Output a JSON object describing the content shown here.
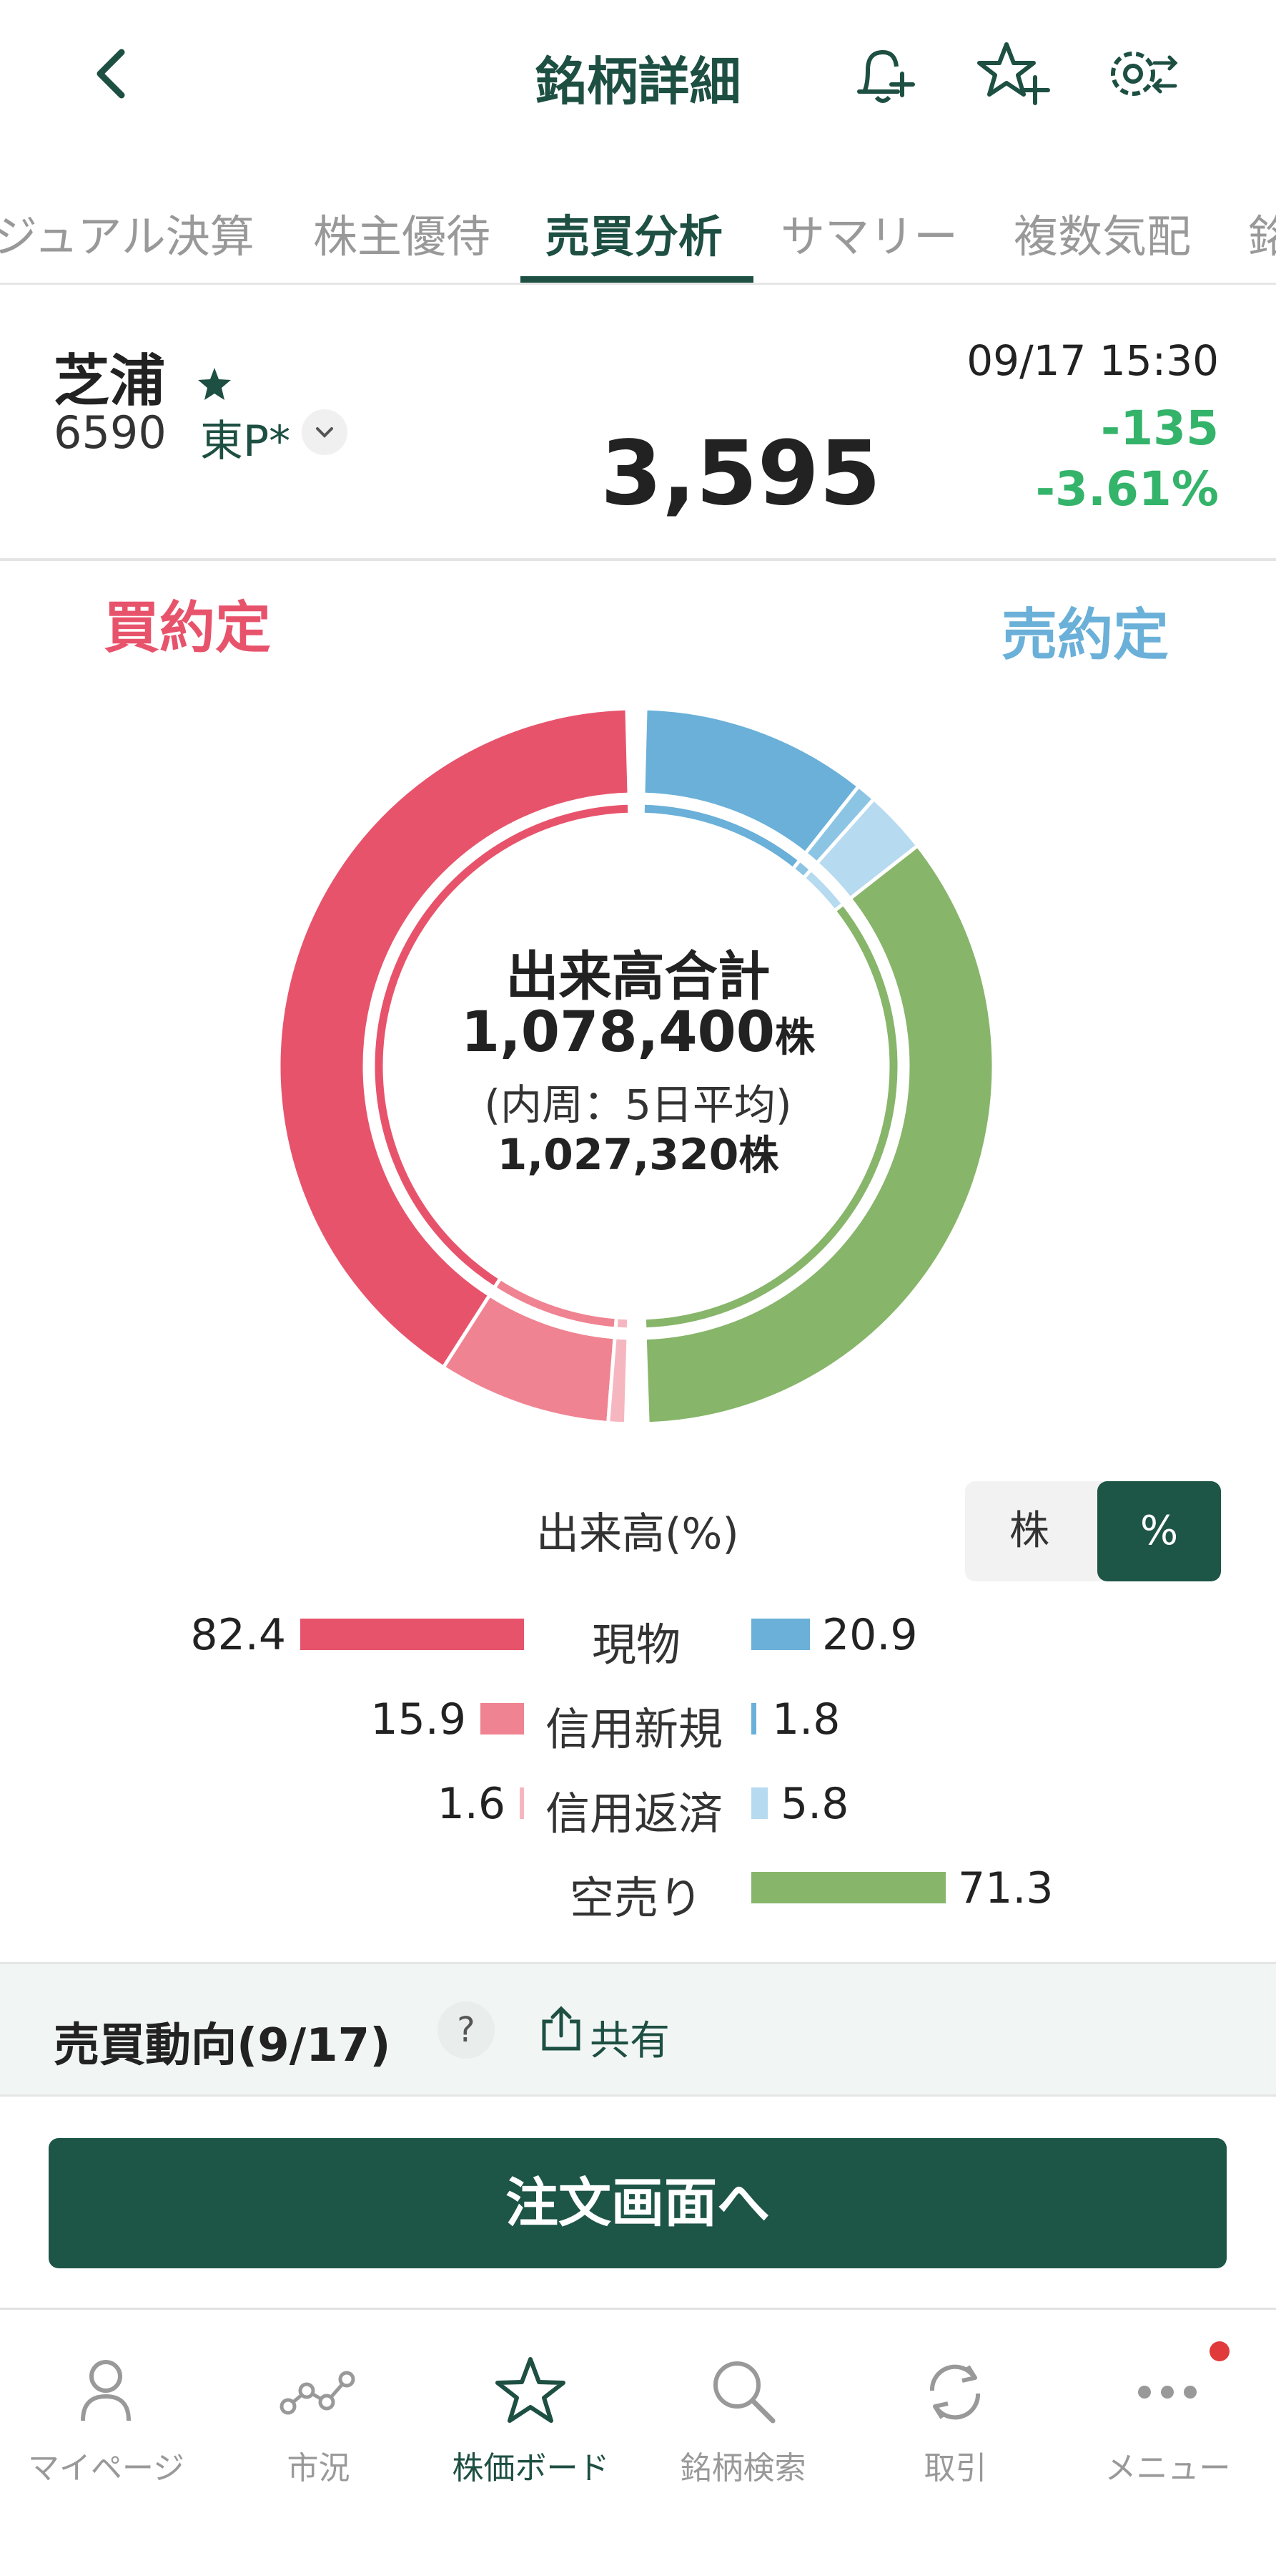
{
  "header": {
    "title": "銘柄詳細",
    "icons": [
      "back-chevron-icon",
      "bell-plus-icon",
      "star-plus-icon",
      "settings-swap-icon"
    ]
  },
  "tabs": [
    {
      "label": "ジュアル決算",
      "active": false
    },
    {
      "label": "株主優待",
      "active": false
    },
    {
      "label": "売買分析",
      "active": true
    },
    {
      "label": "サマリー",
      "active": false
    },
    {
      "label": "複数気配",
      "active": false
    },
    {
      "label": "銘",
      "active": false
    }
  ],
  "stock": {
    "name": "芝浦",
    "favorite": true,
    "code": "6590",
    "market": "東P*",
    "price": "3,595",
    "datetime": "09/17 15:30",
    "change": "-135",
    "change_pct": "-3.61%"
  },
  "analysis": {
    "buy_label": "買約定",
    "sell_label": "売約定",
    "center_title": "出来高合計",
    "total_volume": "1,078,400",
    "unit": "株",
    "inner_note": "(内周：5日平均)",
    "avg_volume": "1,027,320"
  },
  "chart_data": {
    "type": "pie",
    "title": "出来高(%)",
    "outer_ring": {
      "buy": [
        {
          "name": "現物",
          "value": 82.4
        },
        {
          "name": "信用新規",
          "value": 15.9
        },
        {
          "name": "信用返済",
          "value": 1.6
        }
      ],
      "sell": [
        {
          "name": "現物",
          "value": 20.9
        },
        {
          "name": "信用新規",
          "value": 1.8
        },
        {
          "name": "信用返済",
          "value": 5.8
        },
        {
          "name": "空売り",
          "value": 71.3
        }
      ]
    },
    "legend_rows": [
      {
        "label": "現物",
        "buy": "82.4",
        "sell": "20.9"
      },
      {
        "label": "信用新規",
        "buy": "15.9",
        "sell": "1.8"
      },
      {
        "label": "信用返済",
        "buy": "1.6",
        "sell": "5.8"
      },
      {
        "label": "空売り",
        "buy": "",
        "sell": "71.3"
      }
    ],
    "colors": {
      "buy_spot": "#e8536c",
      "buy_margin_new": "#f08391",
      "buy_margin_close": "#f6b6c0",
      "sell_spot": "#6ab0d8",
      "sell_margin_new": "#8cc4e4",
      "sell_margin_close": "#b6daef",
      "short": "#87b56a"
    }
  },
  "volume_legend": {
    "title": "出来高(%)",
    "toggle_share": "株",
    "toggle_pct": "%"
  },
  "trend": {
    "title": "売買動向(9/17)",
    "help": "?",
    "share": "共有"
  },
  "order_button": "注文画面へ",
  "bottom_nav": [
    {
      "label": "マイページ",
      "icon": "person-icon",
      "active": false
    },
    {
      "label": "市況",
      "icon": "market-graph-icon",
      "active": false
    },
    {
      "label": "株価ボード",
      "icon": "star-icon",
      "active": true
    },
    {
      "label": "銘柄検索",
      "icon": "search-icon",
      "active": false
    },
    {
      "label": "取引",
      "icon": "refresh-icon",
      "active": false
    },
    {
      "label": "メニュー",
      "icon": "more-dots-icon",
      "active": false
    }
  ]
}
